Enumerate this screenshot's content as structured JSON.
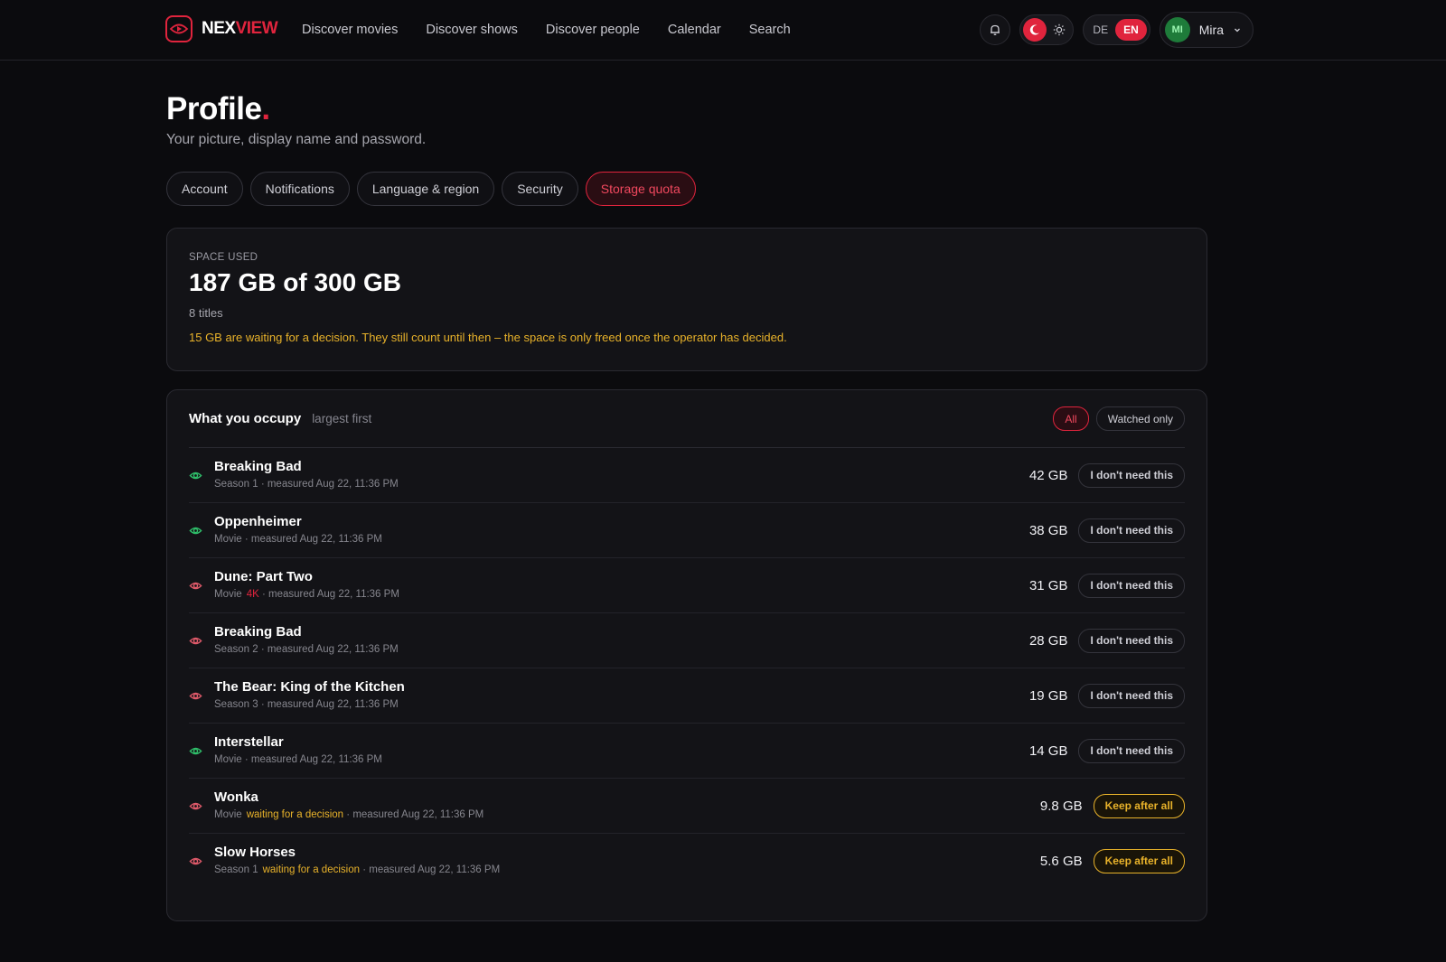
{
  "brand": {
    "part1": "NEX",
    "part2": "VIEW"
  },
  "nav": [
    "Discover movies",
    "Discover shows",
    "Discover people",
    "Calendar",
    "Search"
  ],
  "lang": {
    "de": "DE",
    "en": "EN"
  },
  "user": {
    "initials": "MI",
    "name": "Mira"
  },
  "page": {
    "title": "Profile",
    "title_dot": ".",
    "subtitle": "Your picture, display name and password."
  },
  "tabs": [
    "Account",
    "Notifications",
    "Language & region",
    "Security",
    "Storage quota"
  ],
  "space": {
    "label": "SPACE USED",
    "value": "187 GB of 300 GB",
    "titles": "8 titles",
    "note": "15 GB are waiting for a decision. They still count until then – the space is only freed once the operator has decided."
  },
  "occupy": {
    "title": "What you occupy",
    "subtitle": "largest first",
    "filters": [
      "All",
      "Watched only"
    ],
    "items": [
      {
        "title": "Breaking Bad",
        "kind": "Season 1",
        "tag": "",
        "wait": "",
        "measured": "· measured Aug 22, 11:36 PM",
        "size": "42 GB",
        "action": "I don't need this",
        "watched": true
      },
      {
        "title": "Oppenheimer",
        "kind": "Movie",
        "tag": "",
        "wait": "",
        "measured": "· measured Aug 22, 11:36 PM",
        "size": "38 GB",
        "action": "I don't need this",
        "watched": true
      },
      {
        "title": "Dune: Part Two",
        "kind": "Movie",
        "tag": "4K",
        "wait": "",
        "measured": "· measured Aug 22, 11:36 PM",
        "size": "31 GB",
        "action": "I don't need this",
        "watched": false
      },
      {
        "title": "Breaking Bad",
        "kind": "Season 2",
        "tag": "",
        "wait": "",
        "measured": "· measured Aug 22, 11:36 PM",
        "size": "28 GB",
        "action": "I don't need this",
        "watched": false
      },
      {
        "title": "The Bear: King of the Kitchen",
        "kind": "Season 3",
        "tag": "",
        "wait": "",
        "measured": "· measured Aug 22, 11:36 PM",
        "size": "19 GB",
        "action": "I don't need this",
        "watched": false
      },
      {
        "title": "Interstellar",
        "kind": "Movie",
        "tag": "",
        "wait": "",
        "measured": "· measured Aug 22, 11:36 PM",
        "size": "14 GB",
        "action": "I don't need this",
        "watched": true
      },
      {
        "title": "Wonka",
        "kind": "Movie",
        "tag": "",
        "wait": "waiting for a decision",
        "measured": "· measured Aug 22, 11:36 PM",
        "size": "9.8 GB",
        "action": "Keep after all",
        "watched": false
      },
      {
        "title": "Slow Horses",
        "kind": "Season 1",
        "tag": "",
        "wait": "waiting for a decision",
        "measured": "· measured Aug 22, 11:36 PM",
        "size": "5.6 GB",
        "action": "Keep after all",
        "watched": false
      }
    ]
  },
  "colors": {
    "accent": "#e0243d",
    "watched": "#2fbf6a",
    "unwatched": "#e05a6a",
    "warning": "#e8b22a"
  }
}
